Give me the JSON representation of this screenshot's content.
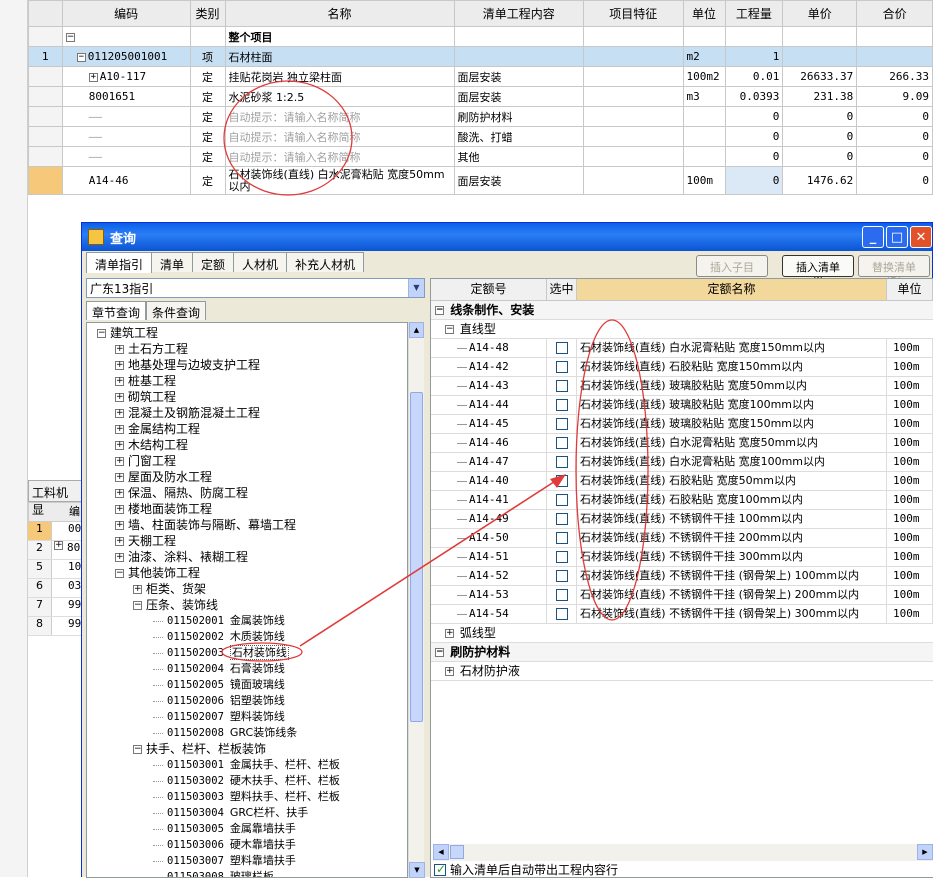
{
  "main_grid": {
    "headers": [
      "编码",
      "类别",
      "名称",
      "清单工程内容",
      "项目特征",
      "单位",
      "工程量",
      "单价",
      "合价"
    ],
    "group_label": "整个项目",
    "rows": [
      {
        "no": "1",
        "code": "011205001001",
        "type": "项",
        "name": "石材柱面",
        "content": "",
        "feature": "",
        "unit": "m2",
        "qty": "1",
        "price": "",
        "total": ""
      },
      {
        "no": "",
        "code": "A10-117",
        "type": "定",
        "name": "挂贴花岗岩 独立梁柱面",
        "content": "面层安装",
        "feature": "",
        "unit": "100m2",
        "qty": "0.01",
        "price": "26633.37",
        "total": "266.33"
      },
      {
        "no": "",
        "code": "8001651",
        "type": "定",
        "name": "水泥砂浆 1:2.5",
        "content": "面层安装",
        "feature": "",
        "unit": "m3",
        "qty": "0.0393",
        "price": "231.38",
        "total": "9.09"
      },
      {
        "no": "",
        "code": "",
        "type": "定",
        "name": "自动提示：请输入名称简称",
        "content": "刷防护材料",
        "feature": "",
        "unit": "",
        "qty": "0",
        "price": "0",
        "total": "0"
      },
      {
        "no": "",
        "code": "",
        "type": "定",
        "name": "自动提示：请输入名称简称",
        "content": "酸洗、打蜡",
        "feature": "",
        "unit": "",
        "qty": "0",
        "price": "0",
        "total": "0"
      },
      {
        "no": "",
        "code": "",
        "type": "定",
        "name": "自动提示：请输入名称简称",
        "content": "其他",
        "feature": "",
        "unit": "",
        "qty": "0",
        "price": "0",
        "total": "0"
      },
      {
        "no": "",
        "code": "A14-46",
        "type": "定",
        "name": "石材装饰线(直线) 白水泥膏粘贴 宽度50mm以内",
        "content": "面层安装",
        "feature": "",
        "unit": "100m",
        "qty": "0",
        "price": "1476.62",
        "total": "0"
      }
    ]
  },
  "sub_panel": {
    "tab": "工料机显",
    "header": "编",
    "rows": [
      {
        "n": "1",
        "v": "00"
      },
      {
        "n": "2",
        "v": "80"
      },
      {
        "n": "5",
        "v": "10"
      },
      {
        "n": "6",
        "v": "03"
      },
      {
        "n": "7",
        "v": "99"
      },
      {
        "n": "8",
        "v": "99"
      }
    ]
  },
  "dialog": {
    "title": "查询",
    "tabs": [
      "清单指引",
      "清单",
      "定额",
      "人材机",
      "补充人材机"
    ],
    "btn_insert_child": "插入子目",
    "btn_insert_list": "插入清单(I)",
    "btn_replace_list": "替换清单(R)",
    "combo_value": "广东13指引",
    "left_tabs": [
      "章节查询",
      "条件查询"
    ],
    "tree": [
      {
        "lvl": 0,
        "pm": "-",
        "code": "",
        "label": "建筑工程"
      },
      {
        "lvl": 1,
        "pm": "+",
        "code": "",
        "label": "土石方工程"
      },
      {
        "lvl": 1,
        "pm": "+",
        "code": "",
        "label": "地基处理与边坡支护工程"
      },
      {
        "lvl": 1,
        "pm": "+",
        "code": "",
        "label": "桩基工程"
      },
      {
        "lvl": 1,
        "pm": "+",
        "code": "",
        "label": "砌筑工程"
      },
      {
        "lvl": 1,
        "pm": "+",
        "code": "",
        "label": "混凝土及钢筋混凝土工程"
      },
      {
        "lvl": 1,
        "pm": "+",
        "code": "",
        "label": "金属结构工程"
      },
      {
        "lvl": 1,
        "pm": "+",
        "code": "",
        "label": "木结构工程"
      },
      {
        "lvl": 1,
        "pm": "+",
        "code": "",
        "label": "门窗工程"
      },
      {
        "lvl": 1,
        "pm": "+",
        "code": "",
        "label": "屋面及防水工程"
      },
      {
        "lvl": 1,
        "pm": "+",
        "code": "",
        "label": "保温、隔热、防腐工程"
      },
      {
        "lvl": 1,
        "pm": "+",
        "code": "",
        "label": "楼地面装饰工程"
      },
      {
        "lvl": 1,
        "pm": "+",
        "code": "",
        "label": "墙、柱面装饰与隔断、幕墙工程"
      },
      {
        "lvl": 1,
        "pm": "+",
        "code": "",
        "label": "天棚工程"
      },
      {
        "lvl": 1,
        "pm": "+",
        "code": "",
        "label": "油漆、涂料、裱糊工程"
      },
      {
        "lvl": 1,
        "pm": "-",
        "code": "",
        "label": "其他装饰工程"
      },
      {
        "lvl": 2,
        "pm": "+",
        "code": "",
        "label": "柜类、货架"
      },
      {
        "lvl": 2,
        "pm": "-",
        "code": "",
        "label": "压条、装饰线"
      },
      {
        "lvl": 3,
        "pm": "",
        "code": "011502001",
        "label": "金属装饰线"
      },
      {
        "lvl": 3,
        "pm": "",
        "code": "011502002",
        "label": "木质装饰线"
      },
      {
        "lvl": 3,
        "pm": "",
        "code": "011502003",
        "label": "石材装饰线",
        "sel": true
      },
      {
        "lvl": 3,
        "pm": "",
        "code": "011502004",
        "label": "石膏装饰线"
      },
      {
        "lvl": 3,
        "pm": "",
        "code": "011502005",
        "label": "镜面玻璃线"
      },
      {
        "lvl": 3,
        "pm": "",
        "code": "011502006",
        "label": "铝塑装饰线"
      },
      {
        "lvl": 3,
        "pm": "",
        "code": "011502007",
        "label": "塑料装饰线"
      },
      {
        "lvl": 3,
        "pm": "",
        "code": "011502008",
        "label": "GRC装饰线条"
      },
      {
        "lvl": 2,
        "pm": "-",
        "code": "",
        "label": "扶手、栏杆、栏板装饰"
      },
      {
        "lvl": 3,
        "pm": "",
        "code": "011503001",
        "label": "金属扶手、栏杆、栏板"
      },
      {
        "lvl": 3,
        "pm": "",
        "code": "011503002",
        "label": "硬木扶手、栏杆、栏板"
      },
      {
        "lvl": 3,
        "pm": "",
        "code": "011503003",
        "label": "塑料扶手、栏杆、栏板"
      },
      {
        "lvl": 3,
        "pm": "",
        "code": "011503004",
        "label": "GRC栏杆、扶手"
      },
      {
        "lvl": 3,
        "pm": "",
        "code": "011503005",
        "label": "金属靠墙扶手"
      },
      {
        "lvl": 3,
        "pm": "",
        "code": "011503006",
        "label": "硬木靠墙扶手"
      },
      {
        "lvl": 3,
        "pm": "",
        "code": "011503007",
        "label": "塑料靠墙扶手"
      },
      {
        "lvl": 3,
        "pm": "",
        "code": "011503008",
        "label": "玻璃栏板"
      }
    ],
    "right_headers": [
      "定额号",
      "选中",
      "定额名称",
      "单位"
    ],
    "group1": "线条制作、安装",
    "subgroup1": "直线型",
    "items": [
      {
        "code": "A14-48",
        "name": "石材装饰线(直线) 白水泥膏粘贴 宽度150mm以内",
        "unit": "100m"
      },
      {
        "code": "A14-42",
        "name": "石材装饰线(直线) 石胶粘贴 宽度150mm以内",
        "unit": "100m"
      },
      {
        "code": "A14-43",
        "name": "石材装饰线(直线) 玻璃胶粘贴 宽度50mm以内",
        "unit": "100m"
      },
      {
        "code": "A14-44",
        "name": "石材装饰线(直线) 玻璃胶粘贴 宽度100mm以内",
        "unit": "100m"
      },
      {
        "code": "A14-45",
        "name": "石材装饰线(直线) 玻璃胶粘贴 宽度150mm以内",
        "unit": "100m"
      },
      {
        "code": "A14-46",
        "name": "石材装饰线(直线) 白水泥膏粘贴 宽度50mm以内",
        "unit": "100m"
      },
      {
        "code": "A14-47",
        "name": "石材装饰线(直线) 白水泥膏粘贴 宽度100mm以内",
        "unit": "100m"
      },
      {
        "code": "A14-40",
        "name": "石材装饰线(直线) 石胶粘贴 宽度50mm以内",
        "unit": "100m"
      },
      {
        "code": "A14-41",
        "name": "石材装饰线(直线) 石胶粘贴 宽度100mm以内",
        "unit": "100m"
      },
      {
        "code": "A14-49",
        "name": "石材装饰线(直线) 不锈钢件干挂 100mm以内",
        "unit": "100m"
      },
      {
        "code": "A14-50",
        "name": "石材装饰线(直线) 不锈钢件干挂 200mm以内",
        "unit": "100m"
      },
      {
        "code": "A14-51",
        "name": "石材装饰线(直线) 不锈钢件干挂 300mm以内",
        "unit": "100m"
      },
      {
        "code": "A14-52",
        "name": "石材装饰线(直线) 不锈钢件干挂 (钢骨架上) 100mm以内",
        "unit": "100m"
      },
      {
        "code": "A14-53",
        "name": "石材装饰线(直线) 不锈钢件干挂 (钢骨架上) 200mm以内",
        "unit": "100m"
      },
      {
        "code": "A14-54",
        "name": "石材装饰线(直线) 不锈钢件干挂 (钢骨架上) 300mm以内",
        "unit": "100m"
      }
    ],
    "subgroup2": "弧线型",
    "group2": "刷防护材料",
    "subgroup3": "石材防护液",
    "auto_checkbox_label": "输入清单后自动带出工程内容行"
  },
  "colors": {
    "title_blue": "#0a5fe8",
    "highlight_header": "#f2d89b",
    "selected_row": "#c7dff3",
    "annotation_red": "#e03a3a"
  }
}
